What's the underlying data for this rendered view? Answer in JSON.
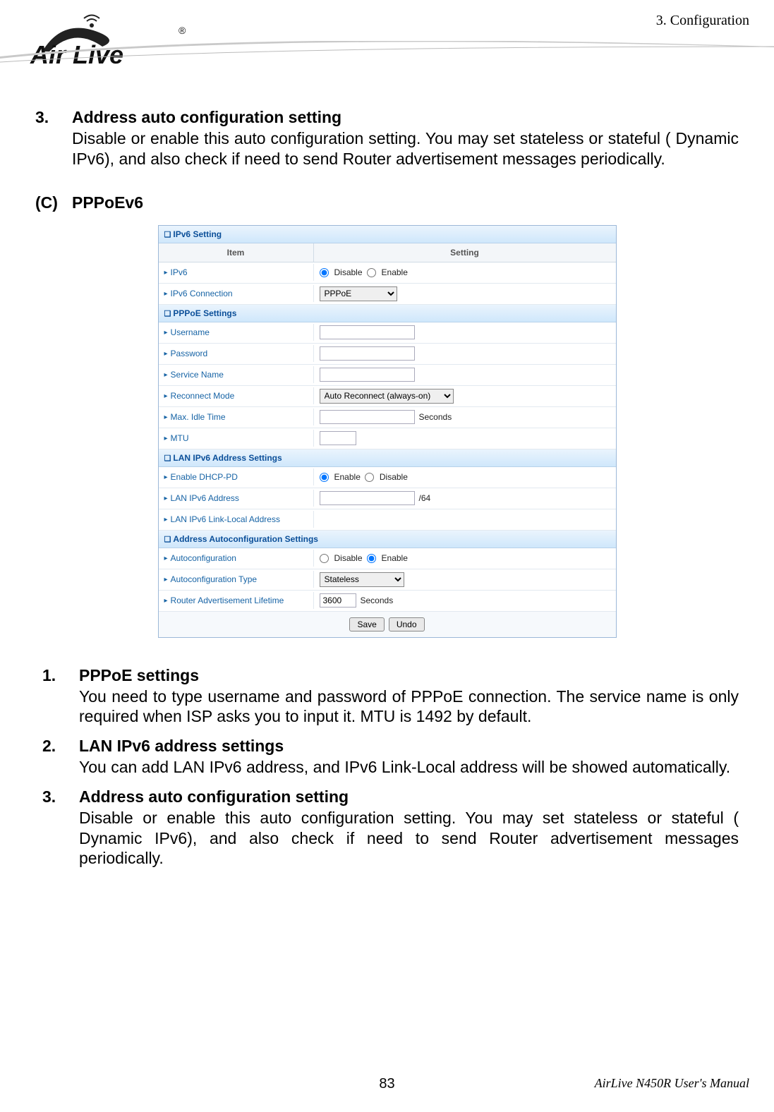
{
  "header": {
    "section_label": "3.  Configuration"
  },
  "logo": {
    "brand": "Air Live",
    "registered": "®"
  },
  "top_section": {
    "num": "3.",
    "title": "Address auto configuration setting",
    "text": "Disable or enable this auto configuration setting. You may set stateless or stateful ( Dynamic IPv6), and also check if need to send Router advertisement messages periodically."
  },
  "subheader": {
    "letter": "(C)",
    "title": "PPPoEv6"
  },
  "screenshot": {
    "sec1": "IPv6 Setting",
    "colhead_item": "Item",
    "colhead_setting": "Setting",
    "rows1": {
      "ipv6": "IPv6",
      "ipv6_opt_disable": "Disable",
      "ipv6_opt_enable": "Enable",
      "ipv6_conn": "IPv6 Connection",
      "ipv6_conn_value": "PPPoE"
    },
    "sec2": "PPPoE Settings",
    "rows2": {
      "username": "Username",
      "password": "Password",
      "service": "Service Name",
      "reconnect": "Reconnect Mode",
      "reconnect_value": "Auto Reconnect (always-on)",
      "maxidle": "Max. Idle Time",
      "seconds": "Seconds",
      "mtu": "MTU"
    },
    "sec3": "LAN IPv6 Address Settings",
    "rows3": {
      "dhcppd": "Enable DHCP-PD",
      "dhcppd_enable": "Enable",
      "dhcppd_disable": "Disable",
      "lanipv6": "LAN IPv6 Address",
      "lanipv6_suffix": "/64",
      "lanlinklocal": "LAN IPv6 Link-Local Address"
    },
    "sec4": "Address Autoconfiguration Settings",
    "rows4": {
      "autoconfig": "Autoconfiguration",
      "ac_disable": "Disable",
      "ac_enable": "Enable",
      "actype": "Autoconfiguration Type",
      "actype_value": "Stateless",
      "ralife": "Router Advertisement Lifetime",
      "ralife_value": "3600",
      "seconds": "Seconds"
    },
    "buttons": {
      "save": "Save",
      "undo": "Undo"
    }
  },
  "bottom_list": [
    {
      "num": "1.",
      "title": "PPPoE settings",
      "text": "You need to type username and password of PPPoE connection. The service name is only required when ISP asks you to input it. MTU is 1492 by default."
    },
    {
      "num": "2.",
      "title": "LAN IPv6 address settings",
      "text": "You can add LAN IPv6 address, and IPv6 Link-Local address will be showed automatically."
    },
    {
      "num": "3.",
      "title": "Address auto configuration setting",
      "text": "Disable or enable this auto configuration setting. You may set stateless or stateful ( Dynamic IPv6), and also check if need to send Router advertisement messages periodically."
    }
  ],
  "footer": {
    "page_num": "83",
    "manual": "AirLive N450R User's Manual"
  }
}
